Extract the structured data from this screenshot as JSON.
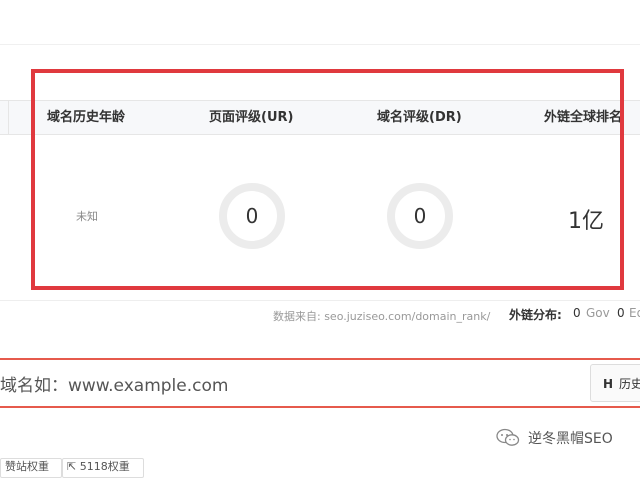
{
  "metrics": {
    "headers": [
      "域名历史年龄",
      "页面评级(UR)",
      "域名评级(DR)",
      "外链全球排名"
    ],
    "domain_age": "未知",
    "ur_value": "0",
    "dr_value": "0",
    "global_rank": "1亿"
  },
  "source": {
    "text": "数据来自: seo.juziseo.com/domain_rank/",
    "dist_label": "外链分布:",
    "gov_count": "0",
    "gov_label": "Gov",
    "edu_count": "0",
    "edu_label": "Ed"
  },
  "search": {
    "value": "域名如：www.example.com",
    "history_key": "H",
    "history_label": "历史"
  },
  "bottom": {
    "pill_a": "赞站权重",
    "pill_b": "5118权重",
    "watermark": "逆冬黑帽SEO"
  }
}
